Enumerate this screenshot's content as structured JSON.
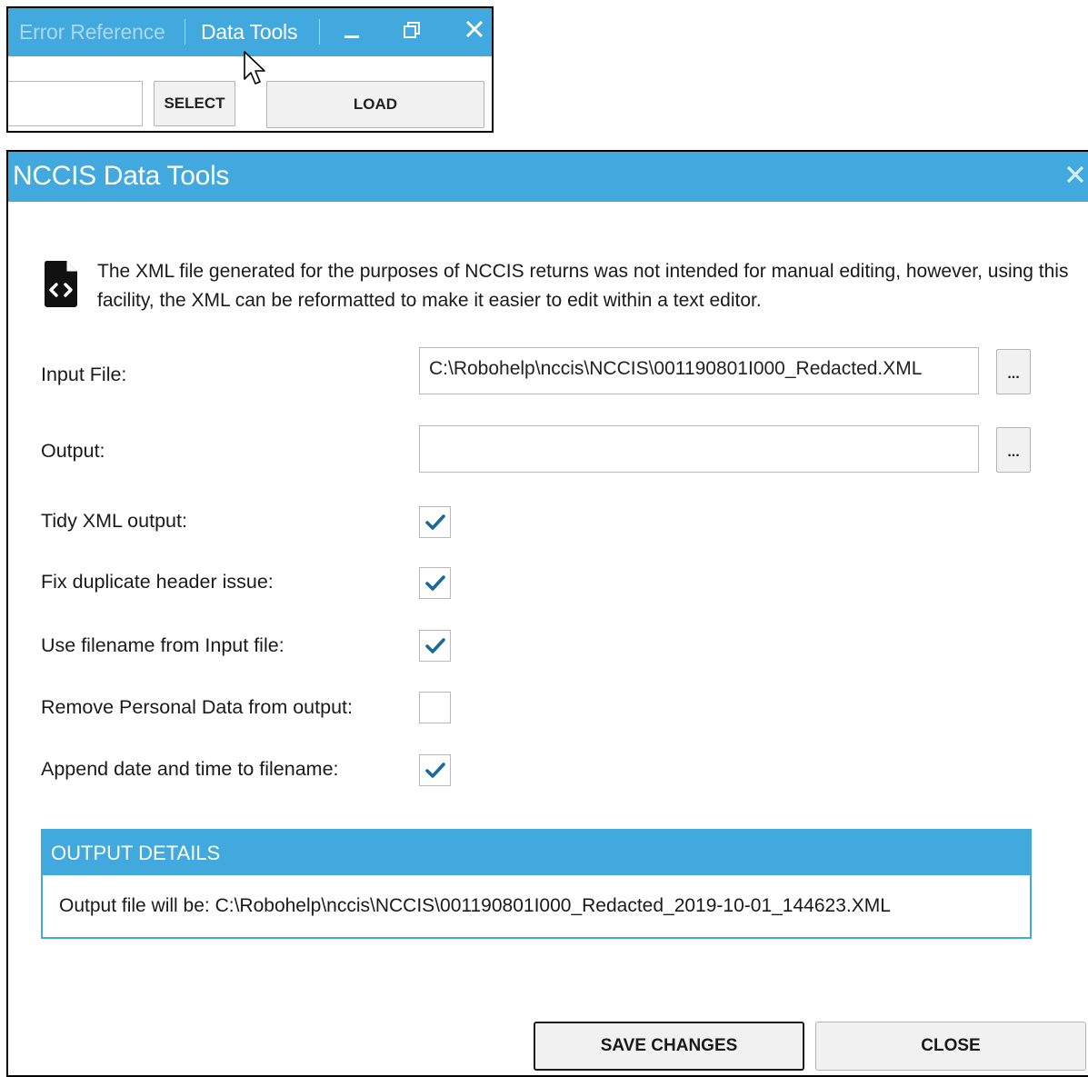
{
  "snippet": {
    "tabs": [
      {
        "label": "Error Reference",
        "active": false
      },
      {
        "label": "Data Tools",
        "active": true
      }
    ],
    "window_controls": [
      "minimize-icon",
      "restore-icon",
      "close-icon"
    ],
    "select_label": "SELECT",
    "load_label": "LOAD"
  },
  "dialog": {
    "title": "NCCIS Data Tools",
    "info_icon": "xml-file-icon",
    "info_text": "The XML file generated for the purposes of NCCIS returns was not intended for manual editing, however, using this facility, the XML can be reformatted to make it easier to edit within a text editor.",
    "input_file": {
      "label": "Input File:",
      "value": "C:\\Robohelp\\nccis\\NCCIS\\001190801I000_Redacted.XML",
      "browse_label": "..."
    },
    "output": {
      "label": "Output:",
      "value": "",
      "browse_label": "..."
    },
    "options": [
      {
        "label": "Tidy XML output:",
        "checked": true
      },
      {
        "label": "Fix duplicate header issue:",
        "checked": true
      },
      {
        "label": "Use filename from Input file:",
        "checked": true
      },
      {
        "label": "Remove Personal Data from output:",
        "checked": false
      },
      {
        "label": "Append date and time to filename:",
        "checked": true
      }
    ],
    "output_details": {
      "header": "OUTPUT DETAILS",
      "prefix": "Output file will be:",
      "path": "C:\\Robohelp\\nccis\\NCCIS\\001190801I000_Redacted_2019-10-01_144623.XML"
    },
    "buttons": {
      "save": "SAVE CHANGES",
      "close": "CLOSE"
    }
  },
  "colors": {
    "accent": "#41a9dd",
    "check": "#1a6a99"
  }
}
